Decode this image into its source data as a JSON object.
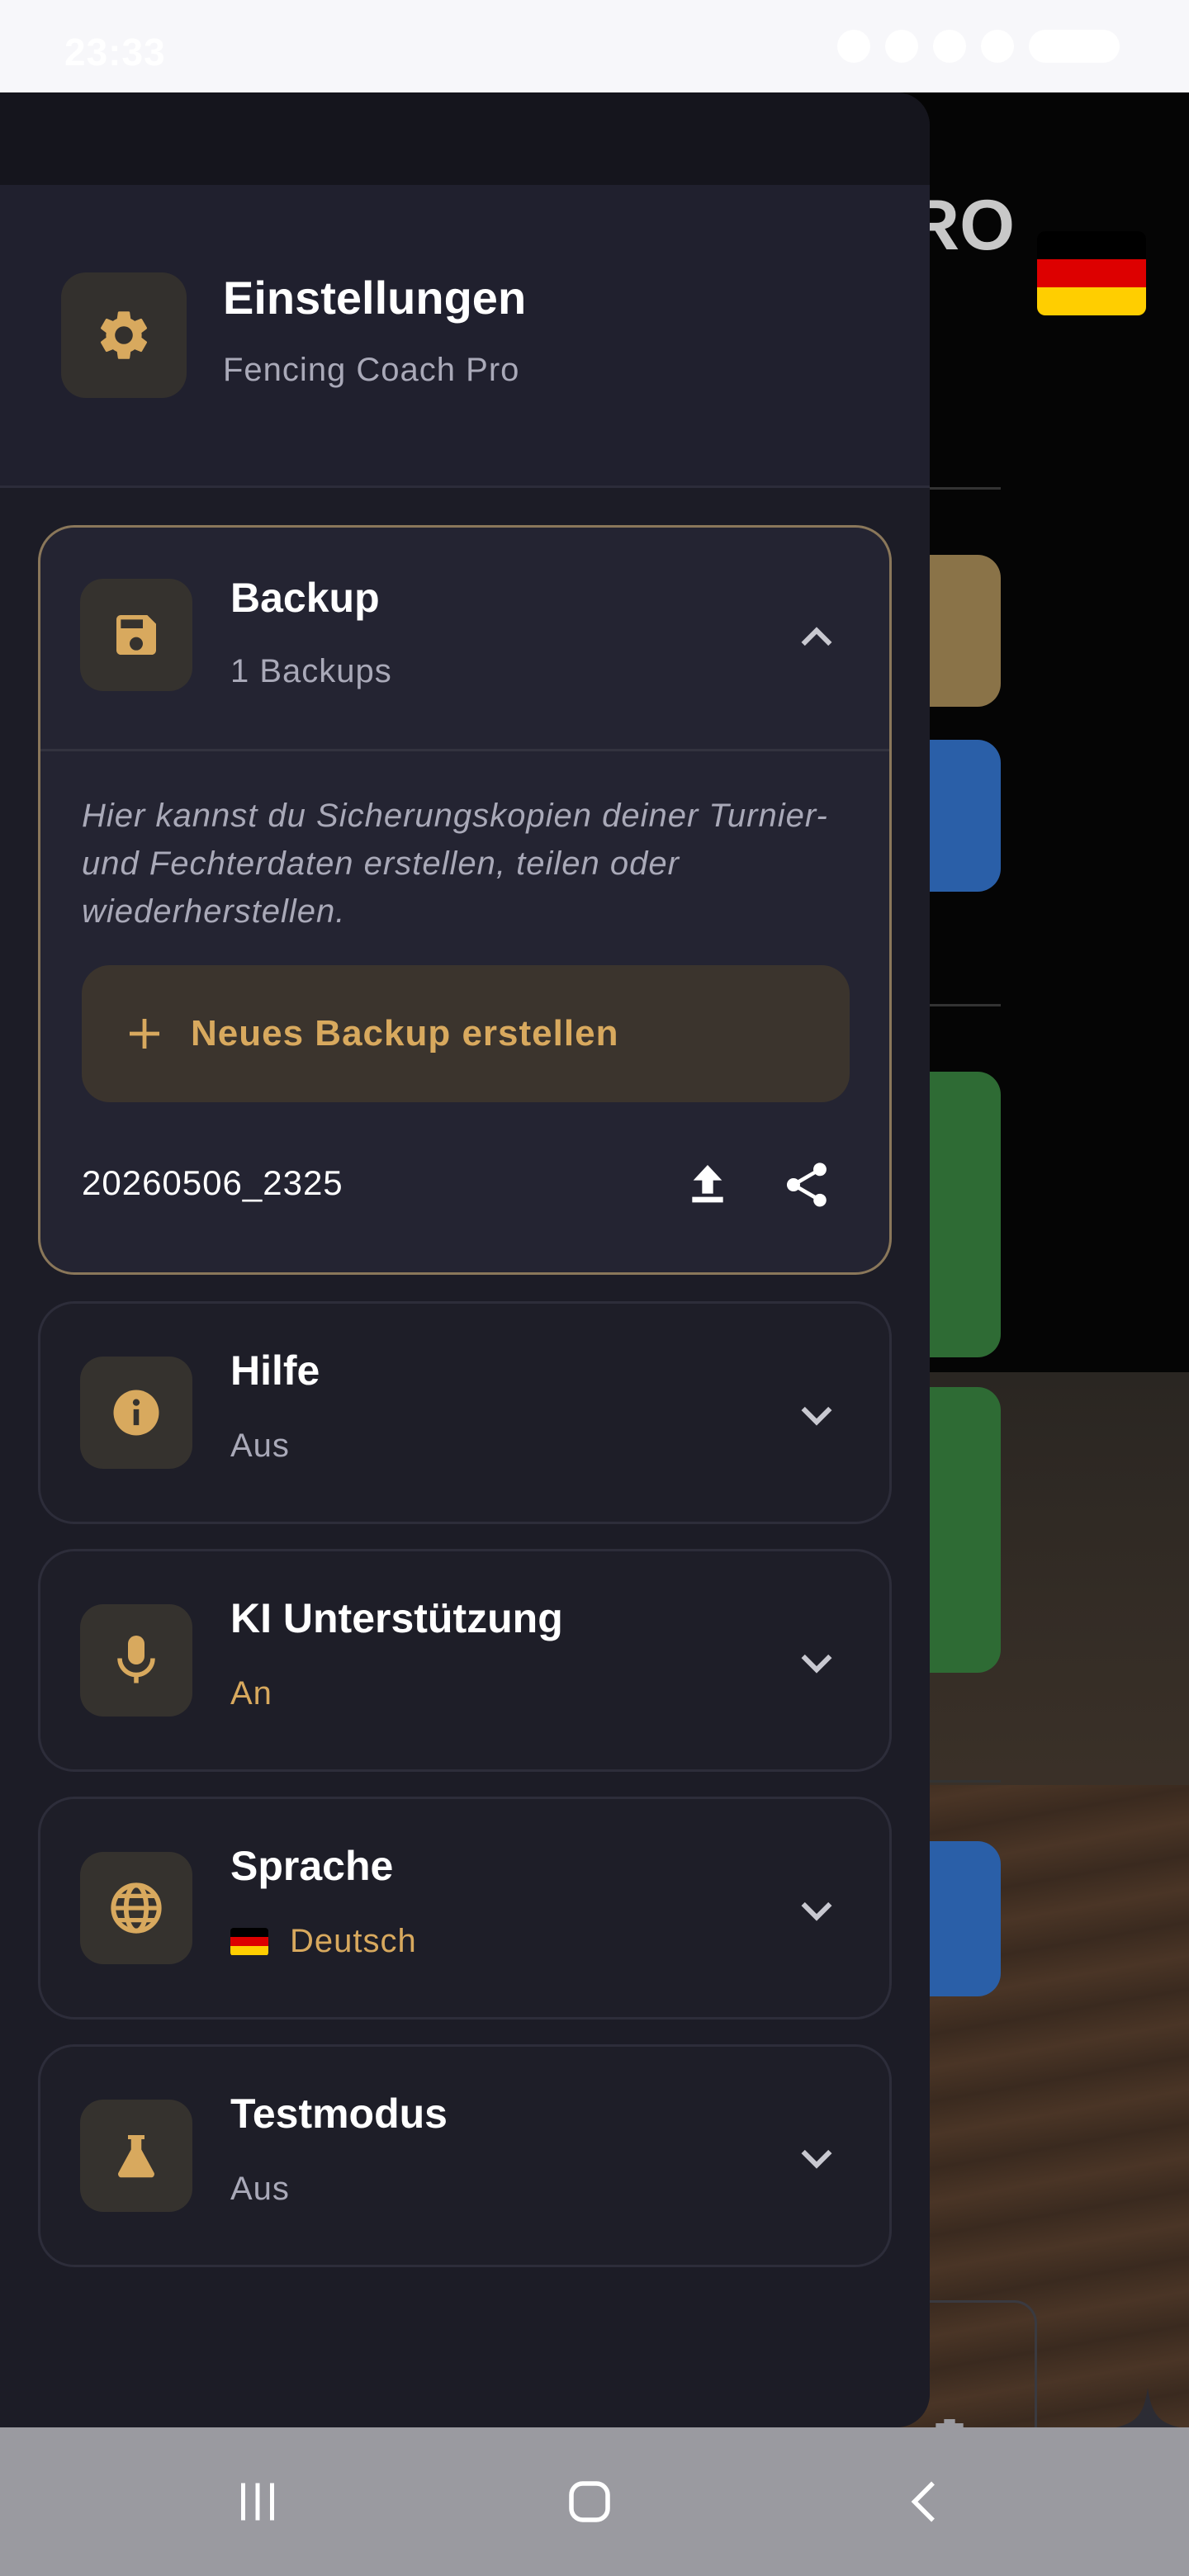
{
  "status_bar": {
    "time": "23:33"
  },
  "background": {
    "title_fragment": "RO"
  },
  "drawer": {
    "title": "Einstellungen",
    "subtitle": "Fencing Coach Pro",
    "sections": {
      "backup": {
        "title": "Backup",
        "subtitle": "1 Backups",
        "expanded": true,
        "description": "Hier kannst du Sicherungskopien deiner Turnier- und Fechterdaten erstellen, teilen oder wiederherstellen.",
        "new_backup_label": "Neues Backup erstellen",
        "items": [
          {
            "name": "20260506_2325"
          }
        ]
      },
      "help": {
        "title": "Hilfe",
        "subtitle": "Aus"
      },
      "ai": {
        "title": "KI Unterstützung",
        "subtitle": "An"
      },
      "language": {
        "title": "Sprache",
        "subtitle": "Deutsch"
      },
      "testmode": {
        "title": "Testmodus",
        "subtitle": "Aus"
      }
    }
  },
  "colors": {
    "accent": "#d8a95e",
    "drawer_bg": "#1c1c26",
    "header_bg": "#20202e",
    "open_border": "#8a775a"
  },
  "icons": [
    "gear-icon",
    "floppy-disk-icon",
    "chevron-up-icon",
    "plus-icon",
    "upload-icon",
    "share-icon",
    "info-icon",
    "chevron-down-icon",
    "microphone-icon",
    "globe-icon",
    "flask-icon",
    "flag-de-icon"
  ]
}
